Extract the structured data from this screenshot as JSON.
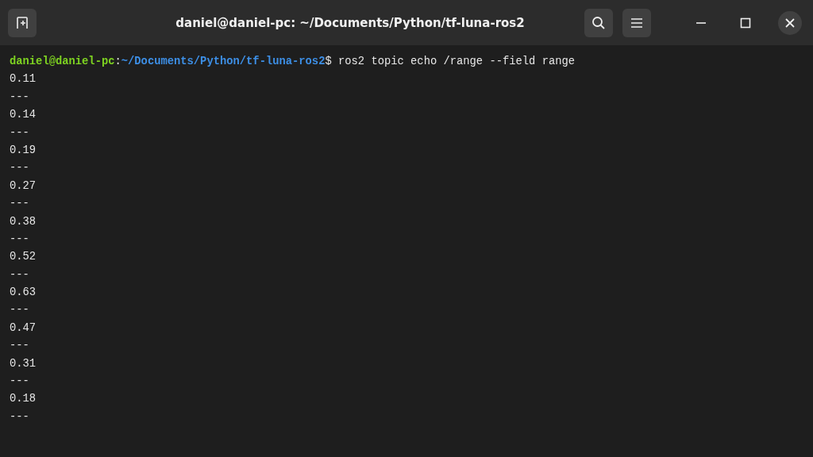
{
  "window": {
    "title": "daniel@daniel-pc: ~/Documents/Python/tf-luna-ros2"
  },
  "prompt": {
    "host": "daniel@daniel-pc",
    "separator": ":",
    "path": "~/Documents/Python/tf-luna-ros2",
    "command": "$ ros2 topic echo /range --field range"
  },
  "output": [
    "0.11",
    "---",
    "0.14",
    "---",
    "0.19",
    "---",
    "0.27",
    "---",
    "0.38",
    "---",
    "0.52",
    "---",
    "0.63",
    "---",
    "0.47",
    "---",
    "0.31",
    "---",
    "0.18",
    "---"
  ]
}
